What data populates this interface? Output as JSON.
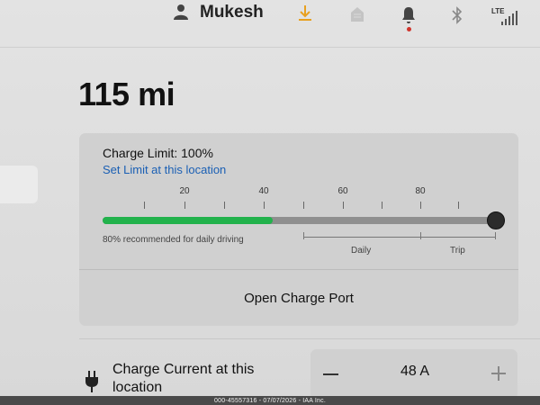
{
  "status_bar": {
    "user_name": "Mukesh",
    "network_label": "LTE",
    "icons": [
      "user-icon",
      "download-icon",
      "home-icon",
      "bell-icon",
      "bluetooth-icon",
      "signal-icon"
    ],
    "download_color": "#e8a020",
    "notification_dot_color": "#d0342c"
  },
  "range": {
    "value": "115 mi"
  },
  "charge_card": {
    "limit_label": "Charge Limit: 100%",
    "set_limit_link": "Set Limit at this location",
    "scale_labels": [
      "20",
      "40",
      "60",
      "80"
    ],
    "charge_level_fraction": 0.43,
    "charge_limit_fraction": 1.0,
    "recommend_note": "80% recommended for daily driving",
    "daily_label": "Daily",
    "trip_label": "Trip",
    "open_port_label": "Open Charge Port",
    "fill_color": "#22b24c"
  },
  "charge_current": {
    "label": "Charge Current at this location",
    "value": "48 A",
    "minus_label": "minus",
    "plus_label": "plus"
  },
  "watermark": {
    "text": "000-45557316 - 07/07/2026 - IAA Inc."
  }
}
